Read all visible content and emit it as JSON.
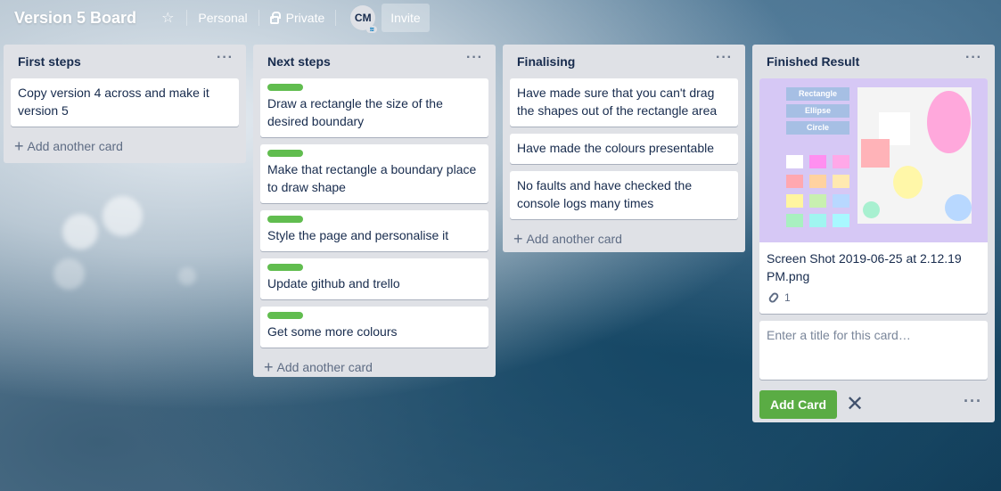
{
  "header": {
    "board_title": "Version 5 Board",
    "visibility_team": "Personal",
    "visibility": "Private",
    "avatar_initials": "CM",
    "invite_label": "Invite"
  },
  "lists": [
    {
      "title": "First steps",
      "cards": [
        {
          "text": "Copy version 4 across and make it version 5",
          "label": false
        }
      ],
      "add_label": "Add another card"
    },
    {
      "title": "Next steps",
      "cards": [
        {
          "text": "Draw a rectangle the size of the desired boundary",
          "label": true
        },
        {
          "text": "Make that rectangle a boundary place to draw shape",
          "label": true
        },
        {
          "text": "Style the page and personalise it",
          "label": true
        },
        {
          "text": "Update github and trello",
          "label": true
        },
        {
          "text": "Get some more colours",
          "label": true
        }
      ],
      "add_label": "Add another card"
    },
    {
      "title": "Finalising",
      "cards": [
        {
          "text": "Have made sure that you can't drag the shapes out of the rectangle area",
          "label": false
        },
        {
          "text": "Have made the colours presentable",
          "label": false
        },
        {
          "text": "No faults and have checked the console logs many times",
          "label": false
        }
      ],
      "add_label": "Add another card"
    },
    {
      "title": "Finished Result",
      "cover_card": {
        "text": "Screen Shot 2019-06-25 at 2.12.19 PM.png",
        "attachments": "1",
        "cover": {
          "buttons": [
            "Rectangle",
            "Ellipse",
            "Circle"
          ]
        }
      },
      "composer": {
        "placeholder": "Enter a title for this card…",
        "add_button": "Add Card"
      }
    }
  ],
  "colors": {
    "label_green": "#61bd4f",
    "add_button": "#5aac44",
    "list_bg": "#dfe1e6"
  }
}
